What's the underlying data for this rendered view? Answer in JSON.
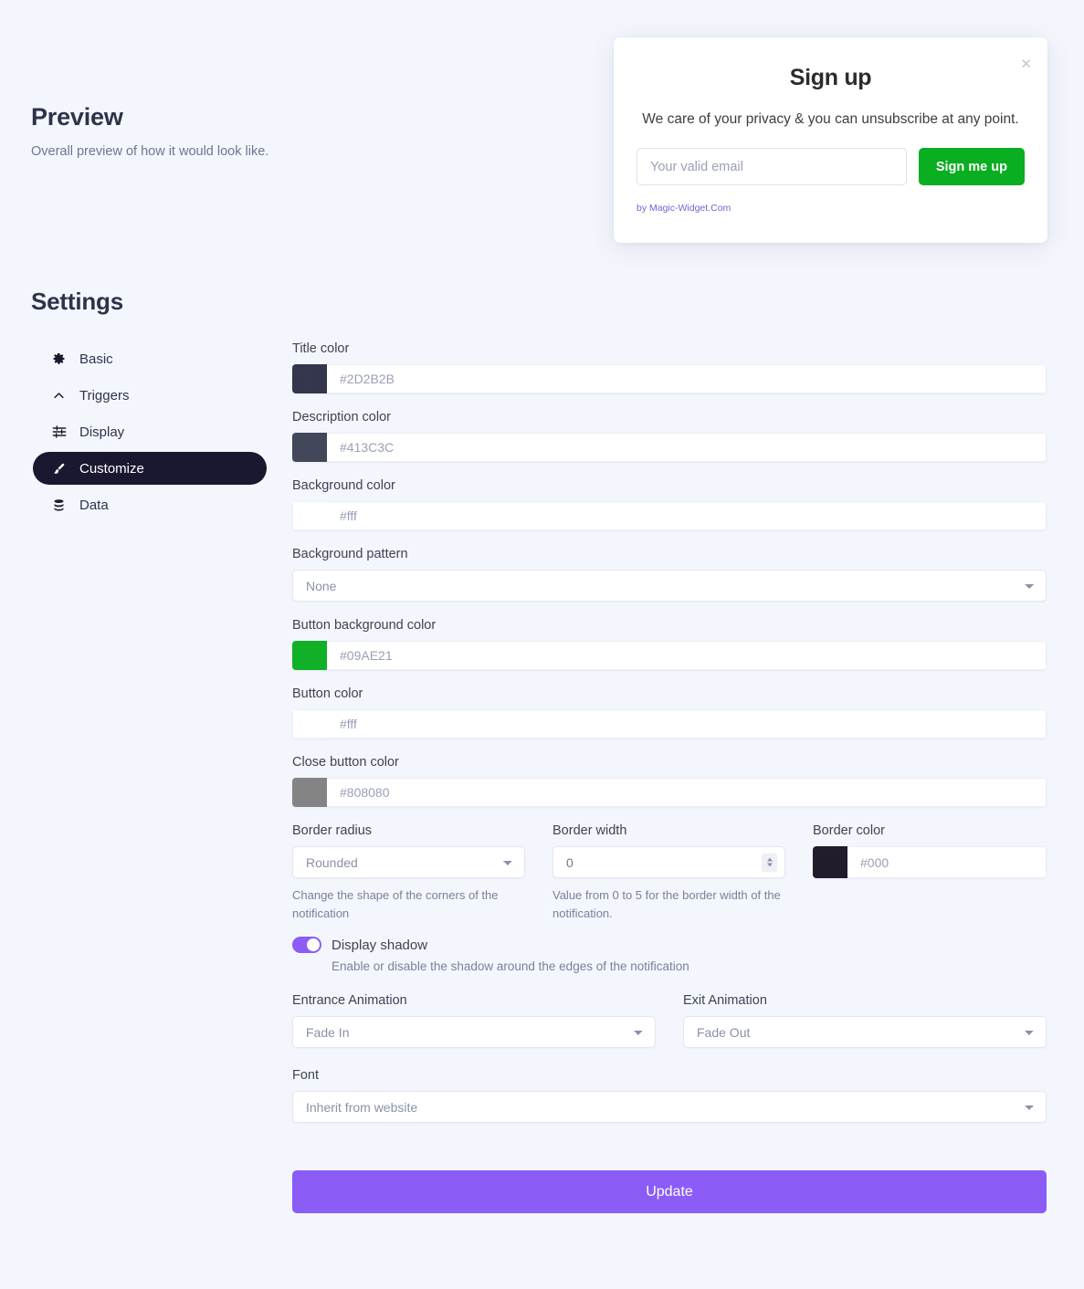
{
  "preview": {
    "title": "Preview",
    "subtitle": "Overall preview of how it would look like."
  },
  "widget": {
    "close_icon": "close-icon",
    "title": "Sign up",
    "description": "We care of your privacy & you can unsubscribe at any point.",
    "email_placeholder": "Your valid email",
    "email_value": "",
    "button_label": "Sign me up",
    "credit": "by Magic-Widget.Com",
    "button_bg": "#09AE21",
    "credit_color": "#7c5fd3"
  },
  "settings": {
    "title": "Settings",
    "sidebar": [
      {
        "label": "Basic",
        "icon": "gear-icon",
        "active": false
      },
      {
        "label": "Triggers",
        "icon": "chevron-up-icon",
        "active": false
      },
      {
        "label": "Display",
        "icon": "sliders-icon",
        "active": false
      },
      {
        "label": "Customize",
        "icon": "brush-icon",
        "active": true
      },
      {
        "label": "Data",
        "icon": "database-icon",
        "active": false
      }
    ]
  },
  "form": {
    "title_color": {
      "label": "Title color",
      "value": "#2D2B2B",
      "swatch": "#2f3148"
    },
    "description_color": {
      "label": "Description color",
      "value": "#413C3C",
      "swatch": "#3c4356"
    },
    "background_color": {
      "label": "Background color",
      "value": "#fff",
      "swatch": "#ffffff"
    },
    "background_pattern": {
      "label": "Background pattern",
      "value": "None",
      "options": [
        "None"
      ]
    },
    "button_bg_color": {
      "label": "Button background color",
      "value": "#09AE21",
      "swatch": "#09ae21"
    },
    "button_color": {
      "label": "Button color",
      "value": "#fff",
      "swatch": "#ffffff"
    },
    "close_button_color": {
      "label": "Close button color",
      "value": "#808080",
      "swatch": "#808080"
    },
    "border_radius": {
      "label": "Border radius",
      "value": "Rounded",
      "options": [
        "Rounded"
      ],
      "hint": "Change the shape of the corners of the notification"
    },
    "border_width": {
      "label": "Border width",
      "value": "0",
      "hint": "Value from 0 to 5 for the border width of the notification."
    },
    "border_color": {
      "label": "Border color",
      "value": "#000",
      "swatch": "#1a1625"
    },
    "display_shadow": {
      "label": "Display shadow",
      "enabled": true,
      "hint": "Enable or disable the shadow around the edges of the notification"
    },
    "entrance_animation": {
      "label": "Entrance Animation",
      "value": "Fade In",
      "options": [
        "Fade In"
      ]
    },
    "exit_animation": {
      "label": "Exit Animation",
      "value": "Fade Out",
      "options": [
        "Fade Out"
      ]
    },
    "font": {
      "label": "Font",
      "value": "Inherit from website",
      "options": [
        "Inherit from website"
      ]
    },
    "update_label": "Update"
  }
}
